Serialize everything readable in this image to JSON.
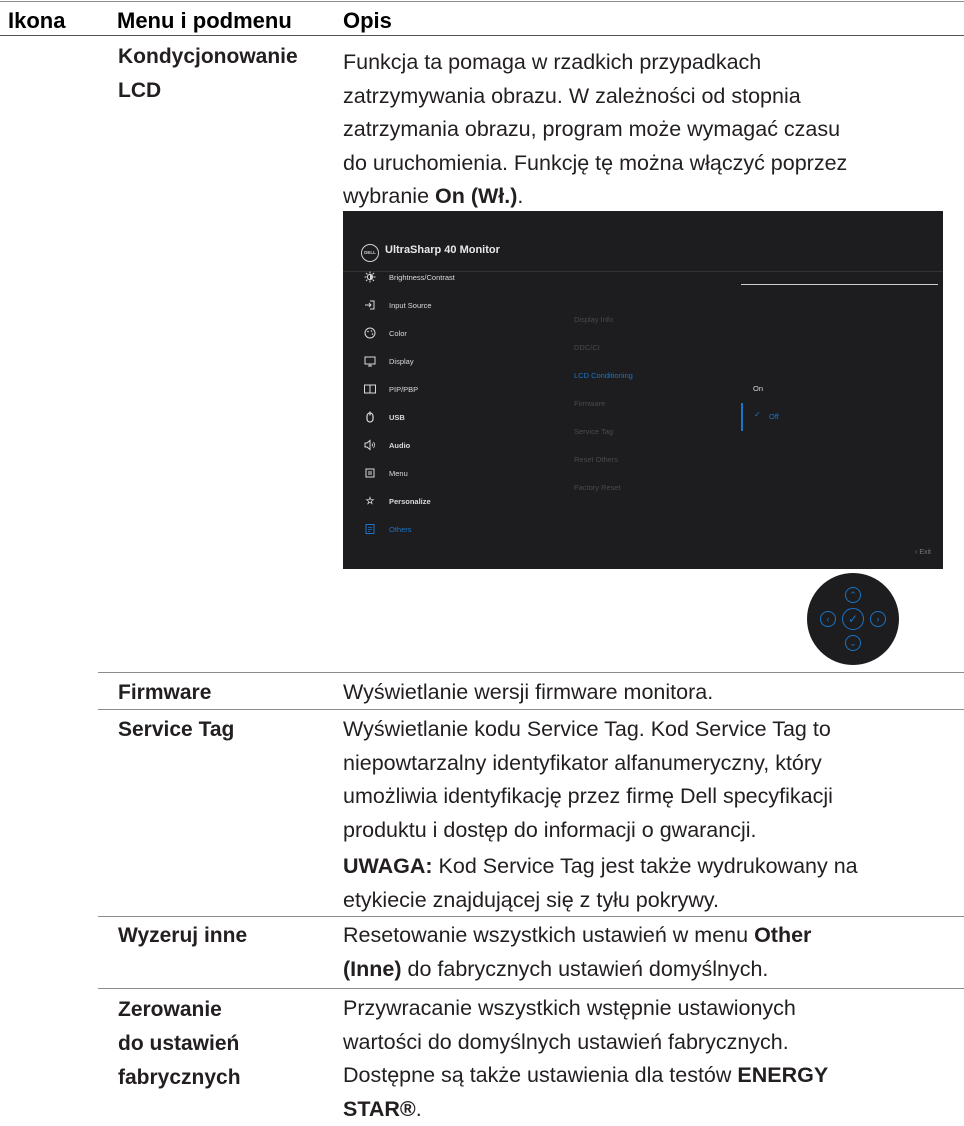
{
  "header": {
    "col_icon": "Ikona",
    "col_menu": "Menu i podmenu",
    "col_desc": "Opis"
  },
  "lcd": {
    "menu_line1": "Kondycjonowanie",
    "menu_line2": "LCD",
    "desc_lines": [
      "Funkcja ta pomaga w rzadkich przypadkach",
      "zatrzymywania obrazu. W zależności od stopnia",
      "zatrzymania obrazu, program może wymagać czasu",
      "do uruchomienia. Funkcję tę można włączyć poprzez"
    ],
    "desc_last_prefix": "wybranie ",
    "desc_last_bold": "On (Wł.)",
    "desc_last_suffix": "."
  },
  "osd": {
    "logo": "DELL",
    "title": "UltraSharp 40 Monitor",
    "menu_items": [
      {
        "label": "Brightness/Contrast",
        "icon": "sun-icon"
      },
      {
        "label": "Input Source",
        "icon": "input-source-icon"
      },
      {
        "label": "Color",
        "icon": "color-palette-icon"
      },
      {
        "label": "Display",
        "icon": "display-icon"
      },
      {
        "label": "PIP/PBP",
        "icon": "pip-pbp-icon"
      },
      {
        "label": "USB",
        "icon": "mouse-icon"
      },
      {
        "label": "Audio",
        "icon": "speaker-icon"
      },
      {
        "label": "Menu",
        "icon": "menu-icon"
      },
      {
        "label": "Personalize",
        "icon": "star-icon"
      },
      {
        "label": "Others",
        "icon": "others-icon"
      }
    ],
    "submenu": [
      "Display Info",
      "DDC/CI",
      "LCD Conditioning",
      "Firmware",
      "Service Tag",
      "Reset Others",
      "Factory Reset"
    ],
    "options": {
      "on": "On",
      "off": "Off"
    },
    "exit": "Exit",
    "accent_color": "#1a74c7"
  },
  "firmware": {
    "menu": "Firmware",
    "desc": "Wyświetlanie wersji firmware monitora."
  },
  "service_tag": {
    "menu": "Service Tag",
    "desc_lines": [
      "Wyświetlanie kodu Service Tag. Kod Service Tag to",
      "niepowtarzalny identyfikator alfanumeryczny, który",
      "umożliwia identyfikację przez firmę Dell specyfikacji",
      "produktu i dostęp do informacji o gwarancji."
    ],
    "note_label": "UWAGA:",
    "note_line1": " Kod Service Tag jest także wydrukowany na",
    "note_line2": "etykiecie znajdującej się z tyłu pokrywy."
  },
  "reset_others": {
    "menu": "Wyzeruj inne",
    "desc_prefix": "Resetowanie wszystkich ustawień w menu ",
    "desc_bold1": "Other",
    "desc_bold2": "(Inne)",
    "desc_suffix": " do fabrycznych ustawień domyślnych."
  },
  "factory_reset": {
    "menu_lines": [
      "Zerowanie",
      "do ustawień",
      "fabrycznych"
    ],
    "desc_lines": [
      "Przywracanie wszystkich wstępnie ustawionych",
      "wartości do domyślnych ustawień fabrycznych."
    ],
    "desc_line3_prefix": "Dostępne są także ustawienia dla testów ",
    "desc_bold1": "ENERGY",
    "desc_bold2": "STAR®",
    "desc_suffix": "."
  }
}
